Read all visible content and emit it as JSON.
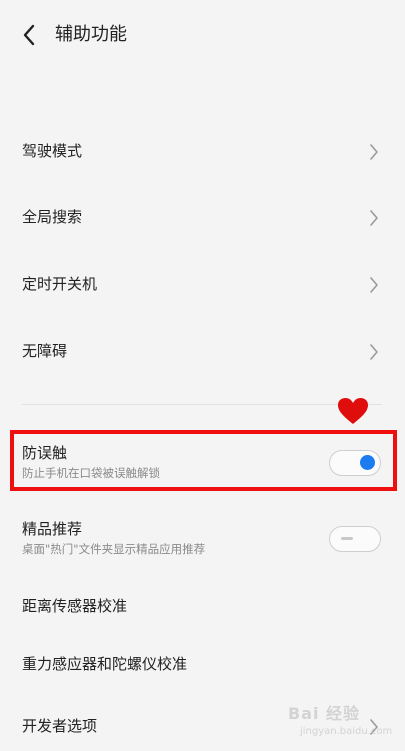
{
  "header": {
    "back_icon": "chevron-left-icon",
    "title": "辅助功能"
  },
  "menu": {
    "items": [
      {
        "label": "驾驶模式",
        "icon": "chevron-right-icon"
      },
      {
        "label": "全局搜索",
        "icon": "chevron-right-icon"
      },
      {
        "label": "定时开关机",
        "icon": "chevron-right-icon"
      },
      {
        "label": "无障碍",
        "icon": "chevron-right-icon"
      }
    ]
  },
  "settings": {
    "anti_mistouch": {
      "label": "防误触",
      "description": "防止手机在口袋被误触解锁",
      "enabled": true
    },
    "recommend": {
      "label": "精品推荐",
      "description": "桌面\"热门\"文件夹显示精品应用推荐",
      "enabled": false
    },
    "proximity": {
      "label": "距离传感器校准"
    },
    "gravity": {
      "label": "重力感应器和陀螺仪校准"
    },
    "developer": {
      "label": "开发者选项",
      "icon": "chevron-right-icon"
    }
  },
  "annotation": {
    "highlight_color": "#ee1010",
    "marker_icon": "heart-icon"
  },
  "watermark": {
    "brand": "Bai 经验",
    "site": "jingyan.baidu.com"
  },
  "colors": {
    "toggle_on": "#1a7cf0",
    "background": "#f4f4f4"
  }
}
